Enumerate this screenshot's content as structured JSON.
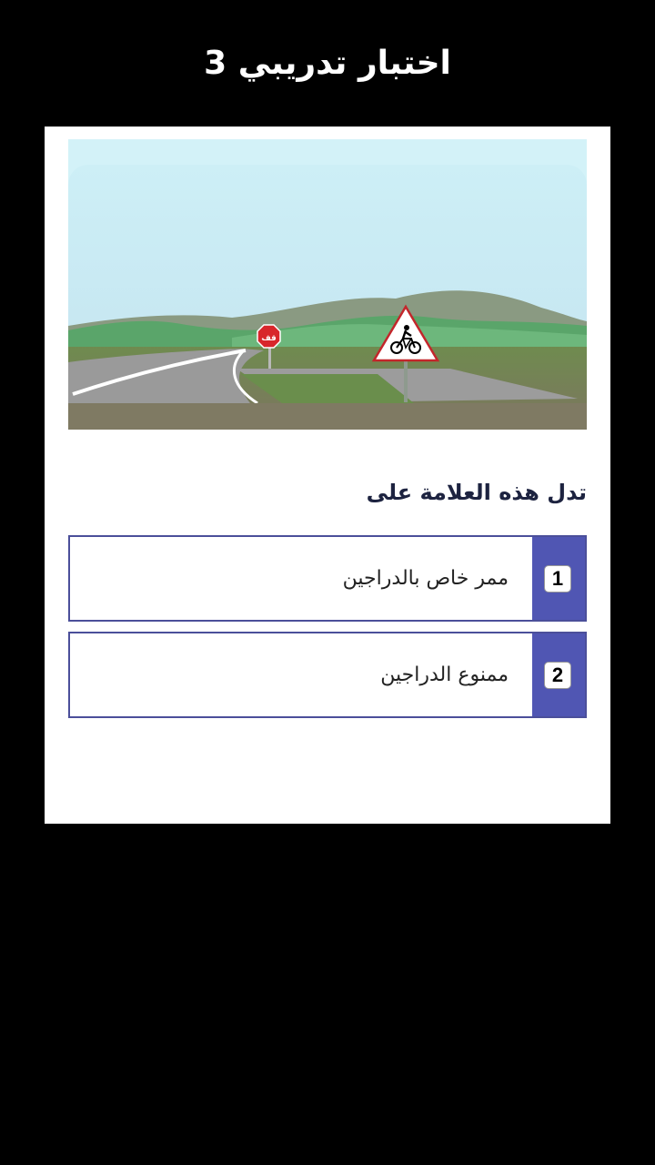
{
  "header": {
    "title": "اختبار تدريبي 3"
  },
  "scene": {
    "stop_sign_text": "قف",
    "warning_sign_icon": "bicycle-icon"
  },
  "question": {
    "text": "تدل هذه العلامة على"
  },
  "options": [
    {
      "number": "1",
      "label": "ممر خاص بالدراجين"
    },
    {
      "number": "2",
      "label": "ممنوع الدراجين"
    }
  ],
  "colors": {
    "background": "#000000",
    "card": "#ffffff",
    "option_border": "#4b4f9a",
    "option_number_bg": "#5056b3",
    "question_text": "#1d2340"
  }
}
